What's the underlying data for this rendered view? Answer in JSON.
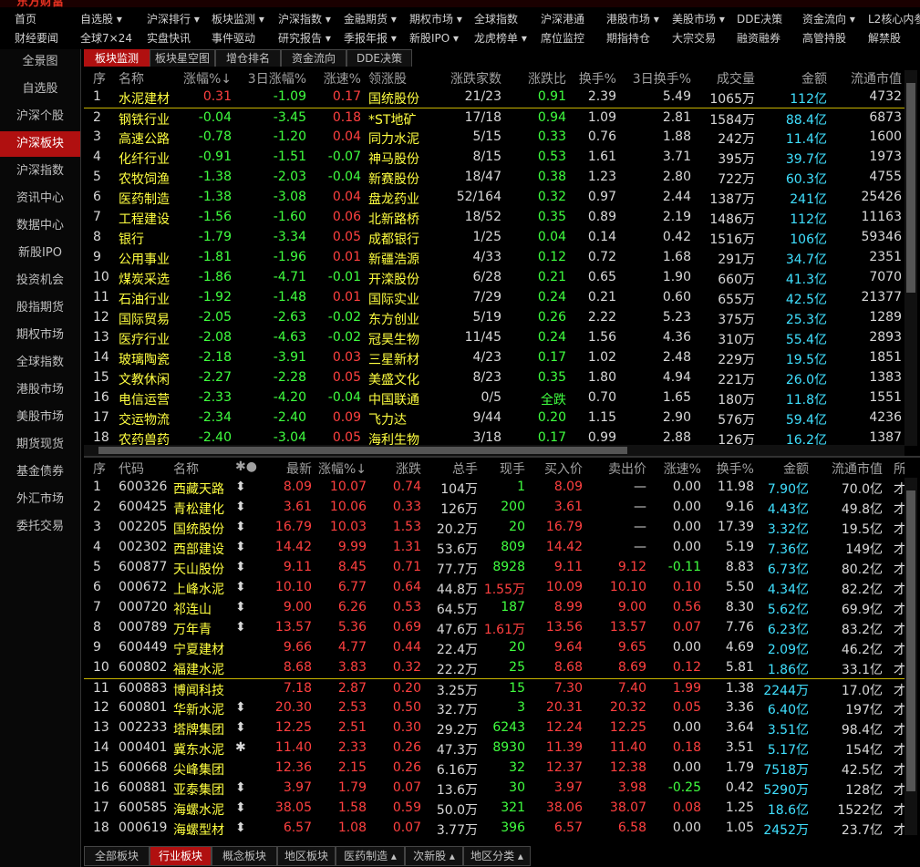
{
  "menu_top": [
    "首页",
    "自选股 ▾",
    "沪深排行 ▾",
    "板块监测 ▾",
    "沪深指数 ▾",
    "金融期货 ▾",
    "期权市场 ▾",
    "全球指数",
    "沪深港通",
    "港股市场 ▾",
    "美股市场 ▾",
    "DDE决策",
    "资金流向 ▾",
    "L2核心内参"
  ],
  "menu_bottom": [
    "财经要闻",
    "全球7×24",
    "实盘快讯",
    "事件驱动",
    "研究报告 ▾",
    "季报年报 ▾",
    "新股IPO ▾",
    "龙虎榜单 ▾",
    "席位监控",
    "期指持仓",
    "大宗交易",
    "融资融券",
    "高管持股",
    "解禁股"
  ],
  "left_nav": [
    "全景图",
    "自选股",
    "沪深个股",
    "沪深板块",
    "沪深指数",
    "资讯中心",
    "数据中心",
    "新股IPO",
    "投资机会",
    "股指期货",
    "期权市场",
    "全球指数",
    "港股市场",
    "美股市场",
    "期货现货",
    "基金债券",
    "外汇市场",
    "委托交易"
  ],
  "top_tabs": [
    "板块监测",
    "板块星空图",
    "增仓排名",
    "资金流向",
    "DDE决策"
  ],
  "sector_headers": [
    "序",
    "名称",
    "涨幅%↓",
    "3日涨幅%",
    "涨速%",
    "领涨股",
    "涨跌家数",
    "涨跌比",
    "换手%",
    "3日换手%",
    "成交量",
    "金额",
    "流通市值"
  ],
  "sectors": [
    [
      "1",
      "水泥建材",
      "0.31",
      "-1.09",
      "0.17",
      "国统股份",
      "21/23",
      "0.91",
      "2.39",
      "5.49",
      "1065万",
      "112亿",
      "4732"
    ],
    [
      "2",
      "钢铁行业",
      "-0.04",
      "-3.45",
      "0.18",
      "*ST地矿",
      "17/18",
      "0.94",
      "1.09",
      "2.81",
      "1584万",
      "88.4亿",
      "6873"
    ],
    [
      "3",
      "高速公路",
      "-0.78",
      "-1.20",
      "0.04",
      "同力水泥",
      "5/15",
      "0.33",
      "0.76",
      "1.88",
      "242万",
      "11.4亿",
      "1600"
    ],
    [
      "4",
      "化纤行业",
      "-0.91",
      "-1.51",
      "-0.07",
      "神马股份",
      "8/15",
      "0.53",
      "1.61",
      "3.71",
      "395万",
      "39.7亿",
      "1973"
    ],
    [
      "5",
      "农牧饲渔",
      "-1.38",
      "-2.03",
      "-0.04",
      "新赛股份",
      "18/47",
      "0.38",
      "1.23",
      "2.80",
      "722万",
      "60.3亿",
      "4755"
    ],
    [
      "6",
      "医药制造",
      "-1.38",
      "-3.08",
      "0.04",
      "盘龙药业",
      "52/164",
      "0.32",
      "0.97",
      "2.44",
      "1387万",
      "241亿",
      "25426"
    ],
    [
      "7",
      "工程建设",
      "-1.56",
      "-1.60",
      "0.06",
      "北新路桥",
      "18/52",
      "0.35",
      "0.89",
      "2.19",
      "1486万",
      "112亿",
      "11163"
    ],
    [
      "8",
      "银行",
      "-1.79",
      "-3.34",
      "0.05",
      "成都银行",
      "1/25",
      "0.04",
      "0.14",
      "0.42",
      "1516万",
      "106亿",
      "59346"
    ],
    [
      "9",
      "公用事业",
      "-1.81",
      "-1.96",
      "0.01",
      "新疆浩源",
      "4/33",
      "0.12",
      "0.72",
      "1.68",
      "291万",
      "34.7亿",
      "2351"
    ],
    [
      "10",
      "煤炭采选",
      "-1.86",
      "-4.71",
      "-0.01",
      "开滦股份",
      "6/28",
      "0.21",
      "0.65",
      "1.90",
      "660万",
      "41.3亿",
      "7070"
    ],
    [
      "11",
      "石油行业",
      "-1.92",
      "-1.48",
      "0.01",
      "国际实业",
      "7/29",
      "0.24",
      "0.21",
      "0.60",
      "655万",
      "42.5亿",
      "21377"
    ],
    [
      "12",
      "国际贸易",
      "-2.05",
      "-2.63",
      "-0.02",
      "东方创业",
      "5/19",
      "0.26",
      "2.22",
      "5.23",
      "375万",
      "25.3亿",
      "1289"
    ],
    [
      "13",
      "医疗行业",
      "-2.08",
      "-4.63",
      "-0.02",
      "冠昊生物",
      "11/45",
      "0.24",
      "1.56",
      "4.36",
      "310万",
      "55.4亿",
      "2893"
    ],
    [
      "14",
      "玻璃陶瓷",
      "-2.18",
      "-3.91",
      "0.03",
      "三星新材",
      "4/23",
      "0.17",
      "1.02",
      "2.48",
      "229万",
      "19.5亿",
      "1851"
    ],
    [
      "15",
      "文教休闲",
      "-2.27",
      "-2.28",
      "0.05",
      "美盛文化",
      "8/23",
      "0.35",
      "1.80",
      "4.94",
      "221万",
      "26.0亿",
      "1383"
    ],
    [
      "16",
      "电信运营",
      "-2.33",
      "-4.20",
      "-0.04",
      "中国联通",
      "0/5",
      "全跌",
      "0.70",
      "1.65",
      "180万",
      "11.8亿",
      "1551"
    ],
    [
      "17",
      "交运物流",
      "-2.34",
      "-2.40",
      "0.09",
      "飞力达",
      "9/44",
      "0.20",
      "1.15",
      "2.90",
      "576万",
      "59.4亿",
      "4236"
    ],
    [
      "18",
      "农药兽药",
      "-2.40",
      "-3.04",
      "0.05",
      "海利生物",
      "3/18",
      "0.17",
      "0.99",
      "2.88",
      "126万",
      "16.2亿",
      "1387"
    ]
  ],
  "stock_headers": [
    "序",
    "代码",
    "名称",
    "✱●",
    "最新",
    "涨幅%↓",
    "涨跌",
    "总手",
    "现手",
    "买入价",
    "卖出价",
    "涨速%",
    "换手%",
    "金额",
    "流通市值",
    "所"
  ],
  "stocks": [
    [
      "1",
      "600326",
      "西藏天路",
      "⬍",
      "8.09",
      "10.07",
      "0.74",
      "104万",
      "1",
      "8.09",
      "—",
      "0.00",
      "11.98",
      "7.90亿",
      "70.0亿",
      "才"
    ],
    [
      "2",
      "600425",
      "青松建化",
      "⬍",
      "3.61",
      "10.06",
      "0.33",
      "126万",
      "200",
      "3.61",
      "—",
      "0.00",
      "9.16",
      "4.43亿",
      "49.8亿",
      "才"
    ],
    [
      "3",
      "002205",
      "国统股份",
      "⬍",
      "16.79",
      "10.03",
      "1.53",
      "20.2万",
      "20",
      "16.79",
      "—",
      "0.00",
      "17.39",
      "3.32亿",
      "19.5亿",
      "才"
    ],
    [
      "4",
      "002302",
      "西部建设",
      "⬍",
      "14.42",
      "9.99",
      "1.31",
      "53.6万",
      "809",
      "14.42",
      "—",
      "0.00",
      "5.19",
      "7.36亿",
      "149亿",
      "才"
    ],
    [
      "5",
      "600877",
      "天山股份",
      "⬍",
      "9.11",
      "8.45",
      "0.71",
      "77.7万",
      "8928",
      "9.11",
      "9.12",
      "-0.11",
      "8.83",
      "6.73亿",
      "80.2亿",
      "才"
    ],
    [
      "6",
      "000672",
      "上峰水泥",
      "⬍",
      "10.10",
      "6.77",
      "0.64",
      "44.8万",
      "1.55万",
      "10.09",
      "10.10",
      "0.10",
      "5.50",
      "4.34亿",
      "82.2亿",
      "才"
    ],
    [
      "7",
      "000720",
      "祁连山",
      "⬍",
      "9.00",
      "6.26",
      "0.53",
      "64.5万",
      "187",
      "8.99",
      "9.00",
      "0.56",
      "8.30",
      "5.62亿",
      "69.9亿",
      "才"
    ],
    [
      "8",
      "000789",
      "万年青",
      "⬍",
      "13.57",
      "5.36",
      "0.69",
      "47.6万",
      "1.61万",
      "13.56",
      "13.57",
      "0.07",
      "7.76",
      "6.23亿",
      "83.2亿",
      "才"
    ],
    [
      "9",
      "600449",
      "宁夏建材",
      "",
      "9.66",
      "4.77",
      "0.44",
      "22.4万",
      "20",
      "9.64",
      "9.65",
      "0.00",
      "4.69",
      "2.09亿",
      "46.2亿",
      "才"
    ],
    [
      "10",
      "600802",
      "福建水泥",
      "",
      "8.68",
      "3.83",
      "0.32",
      "22.2万",
      "25",
      "8.68",
      "8.69",
      "0.12",
      "5.81",
      "1.86亿",
      "33.1亿",
      "才"
    ],
    [
      "11",
      "600883",
      "博闻科技",
      "",
      "7.18",
      "2.87",
      "0.20",
      "3.25万",
      "15",
      "7.30",
      "7.40",
      "1.99",
      "1.38",
      "2244万",
      "17.0亿",
      "才"
    ],
    [
      "12",
      "600801",
      "华新水泥",
      "⬍",
      "20.30",
      "2.53",
      "0.50",
      "32.7万",
      "3",
      "20.31",
      "20.32",
      "0.05",
      "3.36",
      "6.40亿",
      "197亿",
      "才"
    ],
    [
      "13",
      "002233",
      "塔牌集团",
      "⬍",
      "12.25",
      "2.51",
      "0.30",
      "29.2万",
      "6243",
      "12.24",
      "12.25",
      "0.00",
      "3.64",
      "3.51亿",
      "98.4亿",
      "才"
    ],
    [
      "14",
      "000401",
      "冀东水泥",
      "✱",
      "11.40",
      "2.33",
      "0.26",
      "47.3万",
      "8930",
      "11.39",
      "11.40",
      "0.18",
      "3.51",
      "5.17亿",
      "154亿",
      "才"
    ],
    [
      "15",
      "600668",
      "尖峰集团",
      "",
      "12.36",
      "2.15",
      "0.26",
      "6.16万",
      "32",
      "12.37",
      "12.38",
      "0.00",
      "1.79",
      "7518万",
      "42.5亿",
      "才"
    ],
    [
      "16",
      "600881",
      "亚泰集团",
      "⬍",
      "3.97",
      "1.79",
      "0.07",
      "13.6万",
      "30",
      "3.97",
      "3.98",
      "-0.25",
      "0.42",
      "5290万",
      "128亿",
      "才"
    ],
    [
      "17",
      "600585",
      "海螺水泥",
      "⬍",
      "38.05",
      "1.58",
      "0.59",
      "50.0万",
      "321",
      "38.06",
      "38.07",
      "0.08",
      "1.25",
      "18.6亿",
      "1522亿",
      "才"
    ],
    [
      "18",
      "000619",
      "海螺型材",
      "⬍",
      "6.57",
      "1.08",
      "0.07",
      "3.77万",
      "396",
      "6.57",
      "6.58",
      "0.00",
      "1.05",
      "2452万",
      "23.7亿",
      "才"
    ]
  ],
  "bottom_tabs": [
    "全部板块",
    "行业板块",
    "概念板块",
    "地区板块",
    "医药制造 ▴",
    "次新股 ▴",
    "地区分类 ▴"
  ]
}
